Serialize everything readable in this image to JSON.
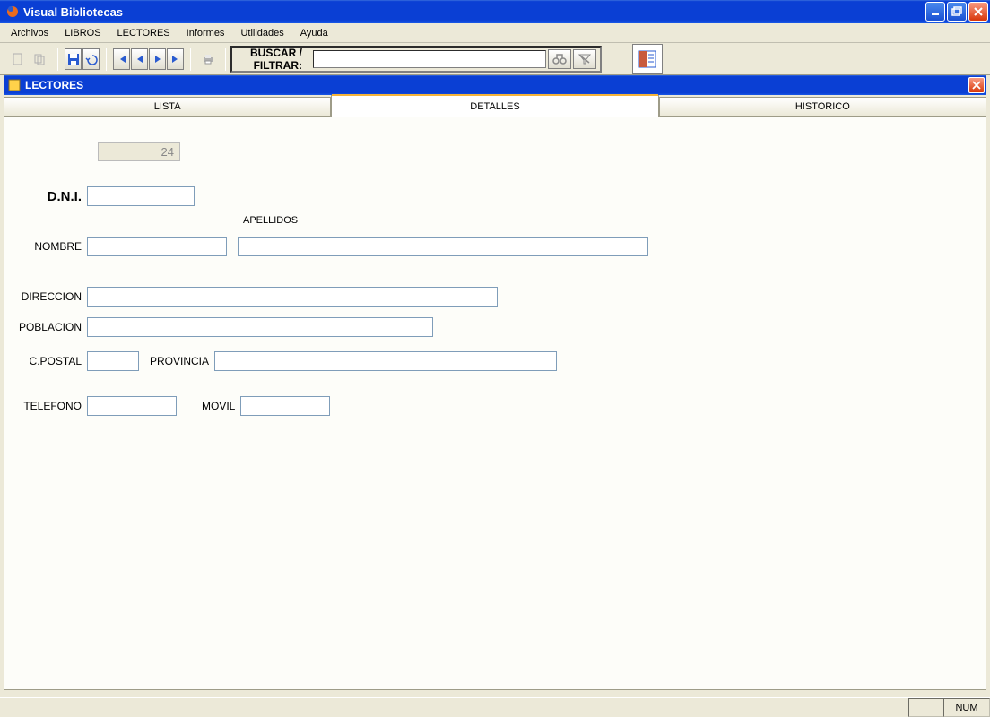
{
  "app": {
    "title": "Visual Bibliotecas"
  },
  "menu": {
    "items": [
      "Archivos",
      "LIBROS",
      "LECTORES",
      "Informes",
      "Utilidades",
      "Ayuda"
    ]
  },
  "toolbar": {
    "search_label": "BUSCAR / FILTRAR:",
    "search_value": ""
  },
  "subwindow": {
    "title": "LECTORES",
    "tabs": [
      "LISTA",
      "DETALLES",
      "HISTORICO"
    ],
    "active_tab": 1
  },
  "form": {
    "id_value": "24",
    "labels": {
      "dni": "D.N.I.",
      "nombre": "NOMBRE",
      "apellidos": "APELLIDOS",
      "direccion": "DIRECCION",
      "poblacion": "POBLACION",
      "cpostal": "C.POSTAL",
      "provincia": "PROVINCIA",
      "telefono": "TELEFONO",
      "movil": "MOVIL"
    },
    "values": {
      "dni": "",
      "nombre": "",
      "apellidos": "",
      "direccion": "",
      "poblacion": "",
      "cpostal": "",
      "provincia": "",
      "telefono": "",
      "movil": ""
    }
  },
  "status": {
    "num": "NUM"
  }
}
